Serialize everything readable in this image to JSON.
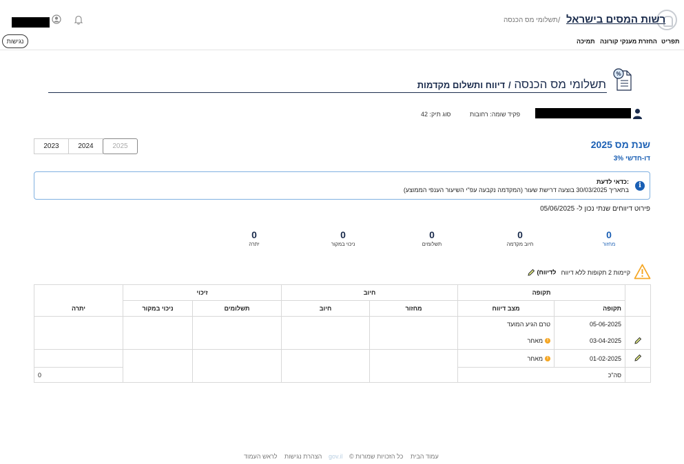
{
  "header": {
    "site_title": "רשות המסים בישראל",
    "breadcrumb_separator": "/",
    "breadcrumb": "תשלומי מס הכנסה",
    "login_button": "נגישות",
    "nav": [
      "תפריט",
      "החזרת מענקי קורונה",
      "תמיכה"
    ]
  },
  "page": {
    "title_main": "תשלומי מס הכנסה",
    "title_sub": "דיווח ותשלום מקדמות",
    "title_separator": "/",
    "clerk": "פקיד שומה: רחובות",
    "file_type": "סוג תיק: 42"
  },
  "years": {
    "tabs": [
      "2023",
      "2024",
      "2025"
    ],
    "active": "2025"
  },
  "tax_year": {
    "label": "שנת מס 2025",
    "frequency_label": "דו-חדשי",
    "rate": "3%"
  },
  "info": {
    "title": "כדאי לדעת:",
    "text": "בתאריך 30/03/2025 בוצעה דרישת שעור (המקדמה נקבעה עפ\"י השיעור הענפי הממוצע)"
  },
  "summary": {
    "date_text": "פירוט דיווחים שנתי נכון ל- 05/06/2025",
    "stats": [
      {
        "value": "0",
        "label": "מחזור"
      },
      {
        "value": "0",
        "label": "חיוב מקדמה"
      },
      {
        "value": "0",
        "label": "תשלומים"
      },
      {
        "value": "0",
        "label": "ניכוי במקור"
      },
      {
        "value": "0",
        "label": "יתרה"
      }
    ]
  },
  "warning": {
    "text": "קיימות 2 תקופות ללא דיווח",
    "link": "(לדיווח"
  },
  "table": {
    "group_headers": {
      "period": "תקופה",
      "charge": "חיוב",
      "credit": "זיכוי"
    },
    "headers": {
      "period": "תקופה",
      "status": "מצב דיווח",
      "turnover": "מחזור",
      "charge": "חיוב",
      "payments": "תשלומים",
      "withholding": "ניכוי במקור",
      "balance": "יתרה"
    },
    "rows": [
      {
        "period": "05-06-2025",
        "status": "טרם הגיע המועד",
        "late": false,
        "editable": false
      },
      {
        "period": "03-04-2025",
        "status": "מאחר",
        "late": true,
        "editable": true
      },
      {
        "period": "01-02-2025",
        "status": "מאחר",
        "late": true,
        "editable": true
      }
    ],
    "total_label": "סה\"כ",
    "total_balance": "0",
    "late_mark": "!"
  },
  "footer": {
    "home": "עמוד הבית",
    "rights": "© כל הזכויות שמורות",
    "gov": "gov.il",
    "accessibility": "הצהרת נגישות",
    "top": "לראש העמוד"
  },
  "colors": {
    "navy": "#1a2b4c",
    "blue": "#1a5fb4",
    "warning": "#f5a623",
    "info_border": "#7fb0e0"
  },
  "icons": [
    "user-icon",
    "bell-icon",
    "logo-icon",
    "document-percent-icon",
    "info-icon",
    "warning-icon",
    "pencil-icon"
  ]
}
